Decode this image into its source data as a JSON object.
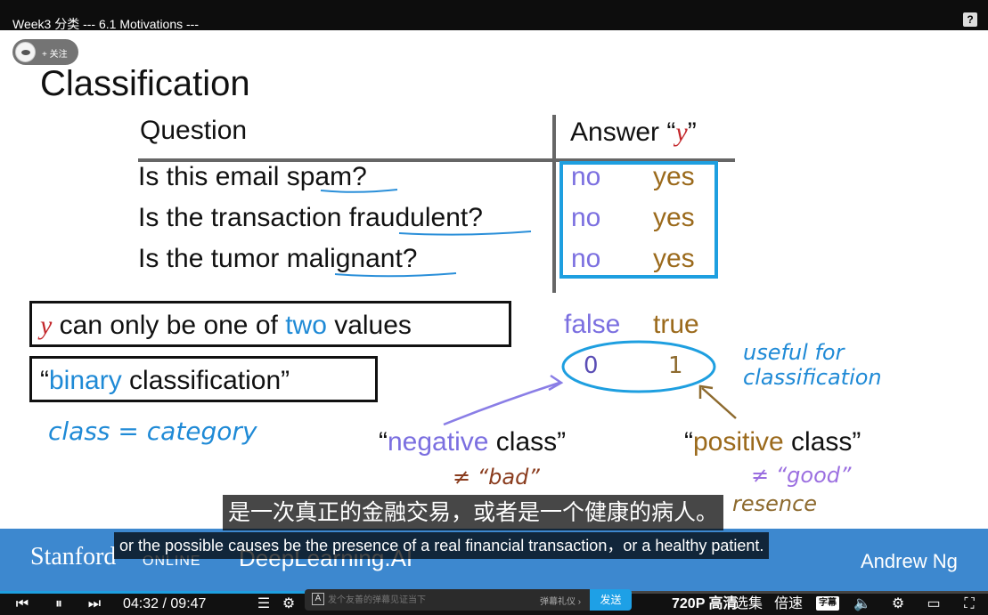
{
  "window": {
    "title": "Week3 分类 --- 6.1 Motivations ---"
  },
  "follow": {
    "label": "+ 关注"
  },
  "slide": {
    "title": "Classification",
    "question_header": "Question",
    "answer_header_prefix": "Answer “",
    "answer_header_var": "y",
    "answer_header_suffix": "”",
    "questions": [
      {
        "text": "Is this email spam?",
        "no": "no",
        "yes": "yes"
      },
      {
        "text": "Is the transaction fraudulent?",
        "no": "no",
        "yes": "yes"
      },
      {
        "text": "Is the tumor malignant?",
        "no": "no",
        "yes": "yes"
      }
    ],
    "box1": {
      "var": "y",
      "middle": " can only be one of ",
      "highlight": "two",
      "end": " values"
    },
    "box2": {
      "quote_open": "“",
      "highlight": "binary",
      "rest": " classification”"
    },
    "false_label": "false",
    "true_label": "true",
    "zero": "0",
    "one": "1",
    "useful_note_1": "useful for",
    "useful_note_2": "classification",
    "class_note": "class = category",
    "negative": {
      "open": "“",
      "word": "negative",
      "rest": " class”"
    },
    "positive": {
      "open": "“",
      "word": "positive",
      "rest": " class”"
    },
    "not_bad": "≠ “bad”",
    "not_good": "≠ “good”",
    "presence_partial": "resence"
  },
  "subtitles": {
    "zh": "是一次真正的金融交易，或者是一个健康的病人。",
    "en": "or the possible causes be the presence of a real financial transaction，or a healthy patient."
  },
  "footer": {
    "stanford": "Stanford",
    "online": "ONLINE",
    "deeplearning": "DeepLearning.AI",
    "author": "Andrew Ng"
  },
  "player": {
    "progress": 0.47,
    "current_time": "04:32",
    "separator": "/",
    "total_time": "09:47",
    "danmaku_placeholder": "发个友善的弹幕见证当下",
    "danmaku_etiquette": "弹幕礼仪 ›",
    "send_label": "发送",
    "quality": "720P 高清",
    "episodes": "选集",
    "speed": "倍速",
    "subtitle_badge": "字幕"
  },
  "colors": {
    "accent": "#1e9fe0",
    "answer_no": "#7b6fe0",
    "answer_yes": "#9b6a1c",
    "blue_text": "#1f8ad6",
    "red_y": "#c3272b"
  }
}
